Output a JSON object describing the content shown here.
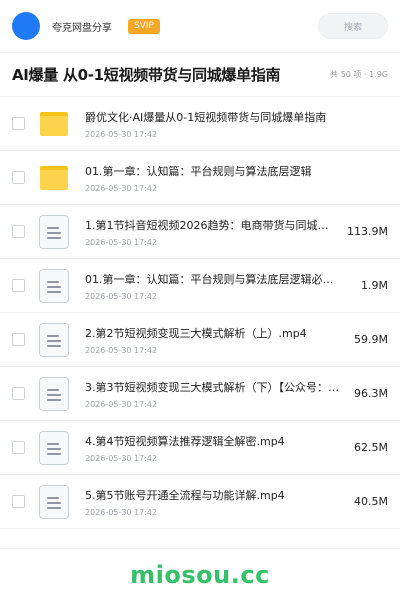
{
  "header": {
    "share_name": "夸克网盘分享",
    "badge": "SVIP",
    "search_placeholder": "搜索"
  },
  "folder": {
    "title": "AI爆量 从0-1短视频带货与同城爆单指南",
    "meta": "共 50 项 · 1.9G"
  },
  "items": [
    {
      "type": "folder",
      "name": "爵优文化·AI爆量从0-1短视频带货与同城爆单指南",
      "date": "2026-05-30 17:42",
      "size": ""
    },
    {
      "type": "folder",
      "name": "01.第一章：认知篇：平台规则与算法底层逻辑",
      "date": "2026-05-30 17:42",
      "size": ""
    },
    {
      "type": "file",
      "name": "1.第1节抖音短视频2026趋势：电商带货与同城赛…",
      "date": "2026-05-30 17:42",
      "size": "113.9M"
    },
    {
      "type": "file",
      "name": "01.第一章：认知篇：平台规则与算法底层逻辑必看.…",
      "date": "2026-05-30 17:42",
      "size": "1.9M"
    },
    {
      "type": "file",
      "name": "2.第2节短视频变现三大模式解析（上）.mp4",
      "date": "2026-05-30 17:42",
      "size": "59.9M"
    },
    {
      "type": "file",
      "name": "3.第3节短视频变现三大模式解析（下）【公众号：密…",
      "date": "2026-05-30 17:42",
      "size": "96.3M"
    },
    {
      "type": "file",
      "name": "4.第4节短视频算法推荐逻辑全解密.mp4",
      "date": "2026-05-30 17:42",
      "size": "62.5M"
    },
    {
      "type": "file",
      "name": "5.第5节账号开通全流程与功能详解.mp4",
      "date": "2026-05-30 17:42",
      "size": "40.5M"
    }
  ],
  "footer": {
    "brand": "miosou.cc"
  },
  "colors": {
    "avatar": "#1e7bf5",
    "badge": "#f5a623",
    "brand": "#35c16a",
    "folder": "#fcd34a"
  }
}
